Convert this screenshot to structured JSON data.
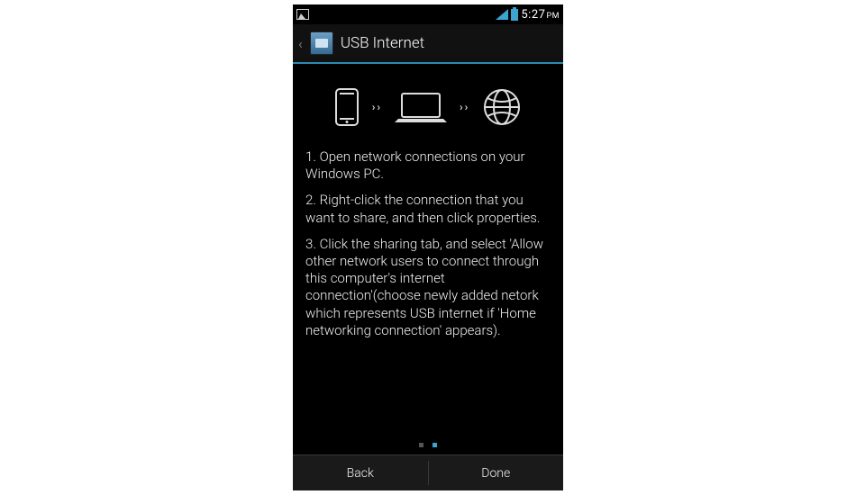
{
  "status": {
    "time": "5:27",
    "ampm": "PM"
  },
  "header": {
    "title": "USB Internet"
  },
  "illustration": {
    "parts": [
      "phone",
      "arrows",
      "laptop",
      "arrows",
      "globe"
    ]
  },
  "steps": {
    "s1": "1. Open network connections on your Windows PC.",
    "s2": "2. Right-click the connection that you want to share, and then click properties.",
    "s3": "3. Click the sharing tab, and select 'Allow other network users to connect through this computer's internet connection'(choose newly added netork which represents USB internet if 'Home networking connection' appears)."
  },
  "pager": {
    "pages": 2,
    "active_index": 1
  },
  "buttons": {
    "back": "Back",
    "done": "Done"
  }
}
